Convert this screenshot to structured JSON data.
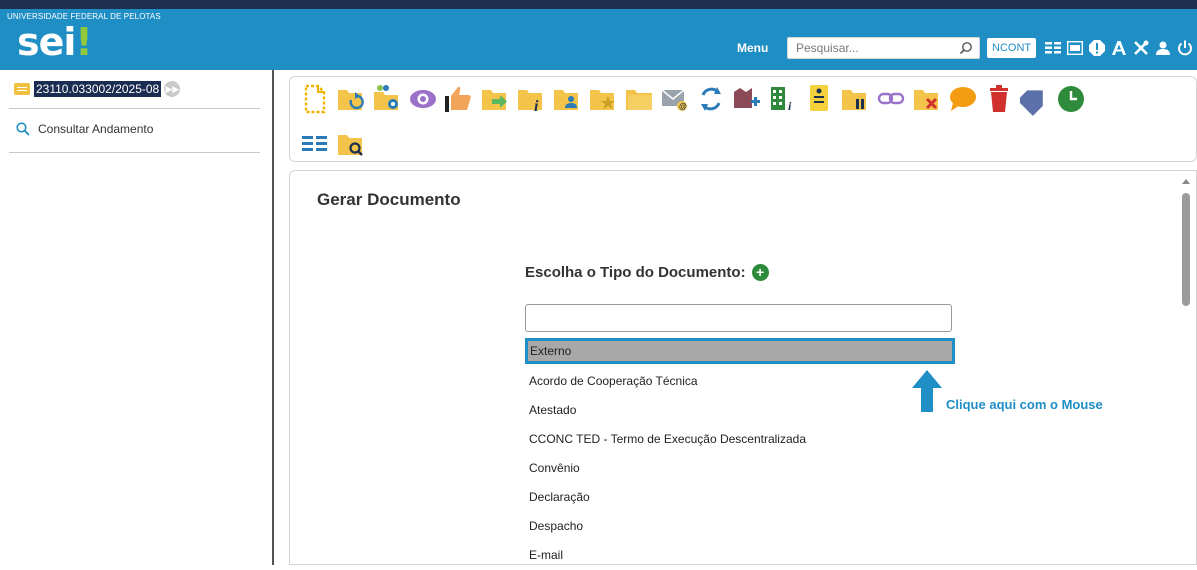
{
  "header": {
    "institution": "UNIVERSIDADE FEDERAL DE PELOTAS",
    "logo_text": "sei",
    "logo_bang": "!",
    "menu_label": "Menu",
    "search_placeholder": "Pesquisar...",
    "unit_label": "NCONT",
    "icons": [
      "list-icon",
      "calendar-icon",
      "alert-icon",
      "font-size-icon",
      "tools-icon",
      "user-icon",
      "power-icon"
    ],
    "accent_color": "#1f8ec5",
    "dark_color": "#1c2f4d"
  },
  "sidebar": {
    "process_number": "23110.033002/2025-08",
    "consultar_label": "Consultar Andamento"
  },
  "toolbar": {
    "row1_icons": [
      "include-document-icon",
      "reopen-process-icon",
      "assign-process-icon",
      "view-icon",
      "give-credit-icon",
      "send-process-icon",
      "process-info-icon",
      "related-process-icon",
      "bookmark-process-icon",
      "folder-icon",
      "send-email-icon",
      "sync-icon",
      "add-interested-icon",
      "units-icon",
      "process-document-icon",
      "suspend-icon",
      "link-icon",
      "delete-process-icon",
      "comment-icon",
      "trash-icon",
      "tag-icon",
      "clock-icon"
    ],
    "row2_icons": [
      "list-view-icon",
      "search-folder-icon"
    ]
  },
  "main": {
    "title": "Gerar Documento",
    "choose_type_label": "Escolha o Tipo do Documento:",
    "filter_value": "",
    "document_types": [
      "Externo",
      "Acordo de Cooperação Técnica",
      "Atestado",
      "CCONC TED - Termo de Execução Descentralizada",
      "Convênio",
      "Declaração",
      "Despacho",
      "E-mail"
    ],
    "selected_index": 0,
    "hint_text": "Clique aqui com o Mouse"
  }
}
